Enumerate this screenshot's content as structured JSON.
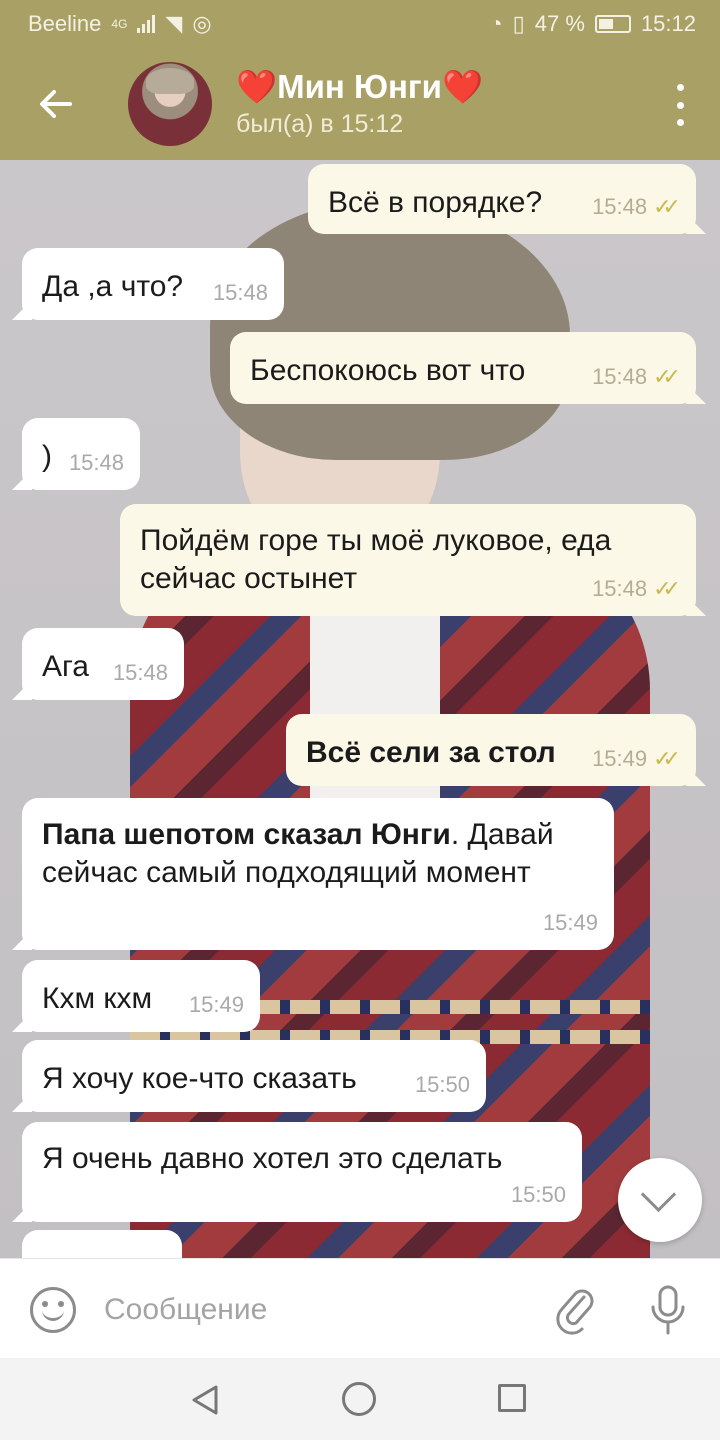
{
  "status_bar": {
    "carrier": "Beeline",
    "network": "4G",
    "battery": "47 %",
    "time": "15:12"
  },
  "header": {
    "title": "❤️Мин Юнги❤️",
    "status": "был(а) в 15:12"
  },
  "messages": [
    {
      "dir": "out",
      "text": "Всё в порядке?",
      "time": "15:48"
    },
    {
      "dir": "in",
      "text": "Да ,а что?",
      "time": "15:48"
    },
    {
      "dir": "out",
      "text": "Беспокоюсь вот что",
      "time": "15:48"
    },
    {
      "dir": "in",
      "text": ")",
      "time": "15:48"
    },
    {
      "dir": "out",
      "text": "Пойдём горе ты моё луковое, еда сейчас остынет",
      "time": "15:48"
    },
    {
      "dir": "in",
      "text": "Ага",
      "time": "15:48"
    },
    {
      "dir": "out",
      "text": "Всё сели за стол",
      "time": "15:49"
    },
    {
      "dir": "in",
      "bold": "Папа шепотом сказал Юнги",
      "text": ". Давай сейчас самый подходящий момент",
      "time": "15:49"
    },
    {
      "dir": "in",
      "text": "Кхм кхм",
      "time": "15:49"
    },
    {
      "dir": "in",
      "text": "Я хочу кое-что сказать",
      "time": "15:50"
    },
    {
      "dir": "in",
      "text": "Я очень давно хотел это сделать",
      "time": "15:50"
    }
  ],
  "input": {
    "placeholder": "Сообщение",
    "value": ""
  },
  "icons": {
    "back": "arrow-left-icon",
    "menu": "more-vertical-icon",
    "emoji": "emoji-icon",
    "attach": "paperclip-icon",
    "mic": "microphone-icon",
    "scroll": "chevron-down-icon"
  },
  "colors": {
    "header": "#a9a066",
    "outgoing_bubble": "#fbf8e8",
    "incoming_bubble": "#ffffff",
    "read_check": "#c9b94e"
  }
}
